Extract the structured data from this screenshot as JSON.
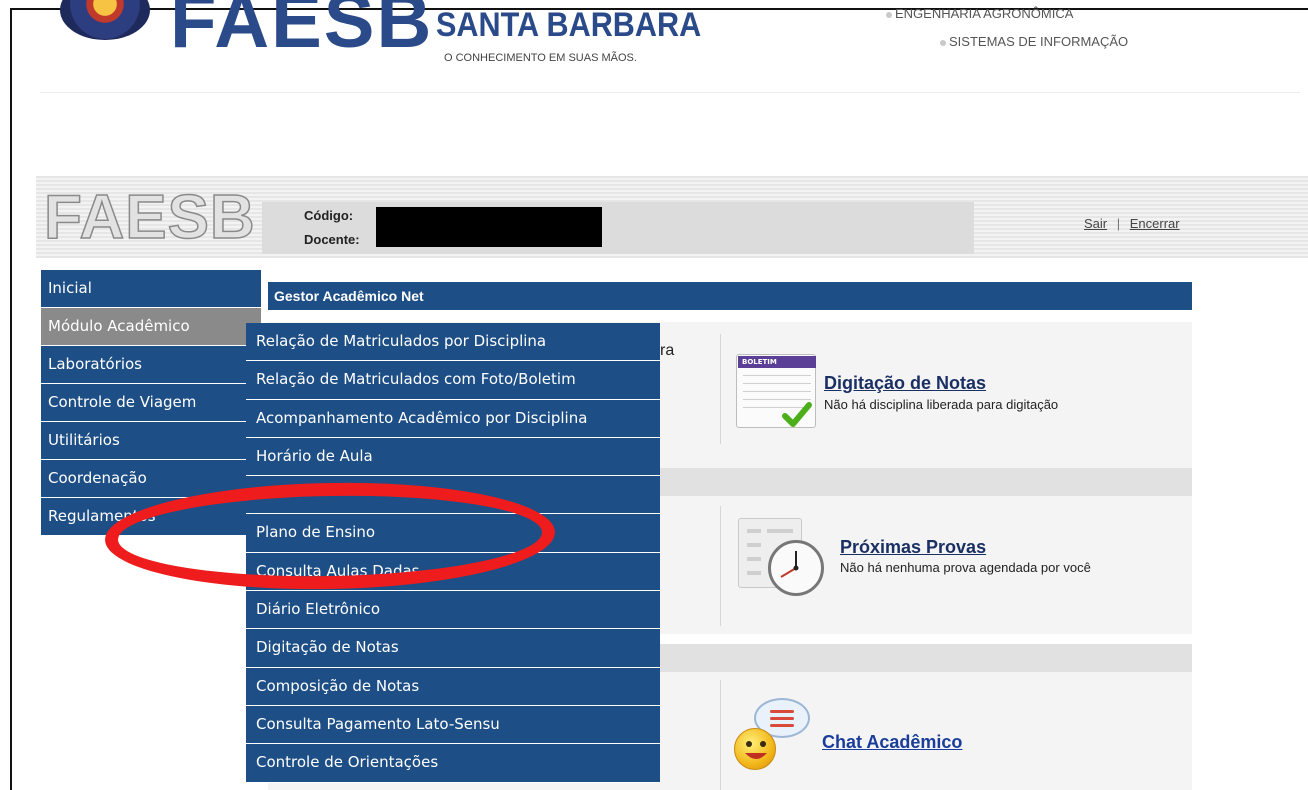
{
  "banner": {
    "logo_text": "FAESB",
    "subtitle": "SANTA BARBARA",
    "slogan": "O CONHECIMENTO EM SUAS MÃOS.",
    "courses": [
      "ENGENHARIA AGRONÔMICA",
      "SISTEMAS DE INFORMAÇÃO"
    ]
  },
  "header": {
    "logo_text": "FAESB",
    "codigo_label": "Código:",
    "docente_label": "Docente:",
    "sair_link": "Sair",
    "separator": "|",
    "encerrar_link": "Encerrar"
  },
  "left_menu": {
    "items": [
      {
        "label": "Inicial"
      },
      {
        "label": "Módulo Acadêmico"
      },
      {
        "label": "Laboratórios"
      },
      {
        "label": "Controle de Viagem"
      },
      {
        "label": "Utilitários"
      },
      {
        "label": "Coordenação"
      },
      {
        "label": "Regulamentos"
      }
    ],
    "active_index": 1
  },
  "submenu": {
    "items": [
      {
        "label": "Relação de Matriculados por Disciplina"
      },
      {
        "label": "Relação de Matriculados com Foto/Boletim"
      },
      {
        "label": "Acompanhamento Acadêmico por Disciplina"
      },
      {
        "label": "Horário de Aula"
      },
      {
        "label": ""
      },
      {
        "label": "Plano de Ensino"
      },
      {
        "label": "Consulta Aulas Dadas"
      },
      {
        "label": "Diário Eletrônico"
      },
      {
        "label": "Digitação de Notas"
      },
      {
        "label": "Composição de Notas"
      },
      {
        "label": "Consulta Pagamento Lato-Sensu"
      },
      {
        "label": "Controle de Orientações"
      }
    ]
  },
  "main": {
    "title": "Gestor Acadêmico Net",
    "peek_text": "ra",
    "widgets": {
      "notas": {
        "title": "Digitação de Notas",
        "description": "Não há disciplina liberada para digitação",
        "icon_bar": "BOLETIM"
      },
      "provas": {
        "title": "Próximas Provas",
        "description": "Não há nenhuma prova agendada por você"
      },
      "chat": {
        "title": "Chat Acadêmico"
      }
    }
  },
  "colors": {
    "menu_blue": "#1d4e85",
    "menu_active": "#8a8a8a",
    "annotation_red": "#ee1c1c"
  }
}
